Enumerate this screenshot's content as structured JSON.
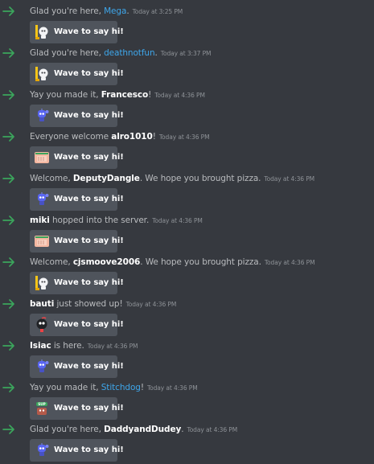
{
  "accent": "#3ba55c",
  "wave_label": "Wave to say hi!",
  "messages": [
    {
      "pre": "Glad you're here, ",
      "user": "Mega",
      "post": ".",
      "time": "Today at 3:25 PM",
      "style": "blue",
      "sticker": "wumpus-wave-sticker"
    },
    {
      "pre": "Glad you're here, ",
      "user": "deathnotfun",
      "post": ".",
      "time": "Today at 3:37 PM",
      "style": "blue",
      "sticker": "wumpus-wave-sticker"
    },
    {
      "pre": "Yay you made it, ",
      "user": "Francesco",
      "post": "!",
      "time": "Today at 4:36 PM",
      "style": "white",
      "sticker": "robot-wave-sticker"
    },
    {
      "pre": "Everyone welcome ",
      "user": "alro1010",
      "post": "!",
      "time": "Today at 4:36 PM",
      "style": "white",
      "sticker": "hand-wave-sticker"
    },
    {
      "pre": "Welcome, ",
      "user": "DeputyDangle",
      "post": ". We hope you brought pizza.",
      "time": "Today at 4:36 PM",
      "style": "white",
      "sticker": "robot-wave-sticker"
    },
    {
      "pre": "",
      "user": "miki",
      "post": " hopped into the server.",
      "time": "Today at 4:36 PM",
      "style": "white",
      "sticker": "hand-wave-sticker"
    },
    {
      "pre": "Welcome, ",
      "user": "cjsmoove2006",
      "post": ". We hope you brought pizza.",
      "time": "Today at 4:36 PM",
      "style": "white",
      "sticker": "wumpus-wave-sticker"
    },
    {
      "pre": "",
      "user": "bauti",
      "post": " just showed up!",
      "time": "Today at 4:36 PM",
      "style": "white",
      "sticker": "bomb-wave-sticker"
    },
    {
      "pre": "",
      "user": "Isiac",
      "post": " is here.",
      "time": "Today at 4:36 PM",
      "style": "white",
      "sticker": "robot-wave-sticker"
    },
    {
      "pre": "Yay you made it, ",
      "user": "Stitchdog",
      "post": "!",
      "time": "Today at 4:36 PM",
      "style": "blue",
      "sticker": "sup-wave-sticker"
    },
    {
      "pre": "Glad you're here, ",
      "user": "DaddyandDudey",
      "post": ".",
      "time": "Today at 4:36 PM",
      "style": "white",
      "sticker": "robot-wave-sticker"
    }
  ]
}
